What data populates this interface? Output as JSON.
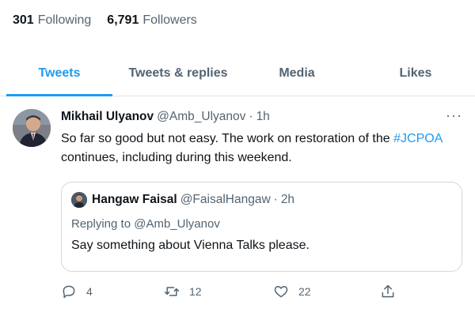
{
  "stats": {
    "following_count": "301",
    "following_label": "Following",
    "followers_count": "6,791",
    "followers_label": "Followers"
  },
  "tabs": [
    {
      "label": "Tweets",
      "active": true
    },
    {
      "label": "Tweets & replies",
      "active": false
    },
    {
      "label": "Media",
      "active": false
    },
    {
      "label": "Likes",
      "active": false
    }
  ],
  "tweet": {
    "name": "Mikhail Ulyanov",
    "handle": "@Amb_Ulyanov",
    "separator": "·",
    "time": "1h",
    "more_label": "···",
    "text_before": "So far so good but not easy. The work on restoration of the ",
    "hashtag": "#JCPOA",
    "text_after": " continues, including during this weekend.",
    "quoted": {
      "name": "Hangaw Faisal",
      "handle": "@FaisalHangaw",
      "separator": "·",
      "time": "2h",
      "replying_prefix": "Replying to",
      "replying_to": "@Amb_Ulyanov",
      "text": "Say something about Vienna Talks please."
    },
    "actions": {
      "reply_icon": "reply-icon",
      "reply_count": "4",
      "retweet_icon": "retweet-icon",
      "retweet_count": "12",
      "like_icon": "heart-icon",
      "like_count": "22",
      "share_icon": "share-icon"
    }
  },
  "colors": {
    "accent": "#1d9bf0",
    "text_primary": "#0f1419",
    "text_secondary": "#536471",
    "border": "#cfd9de"
  }
}
